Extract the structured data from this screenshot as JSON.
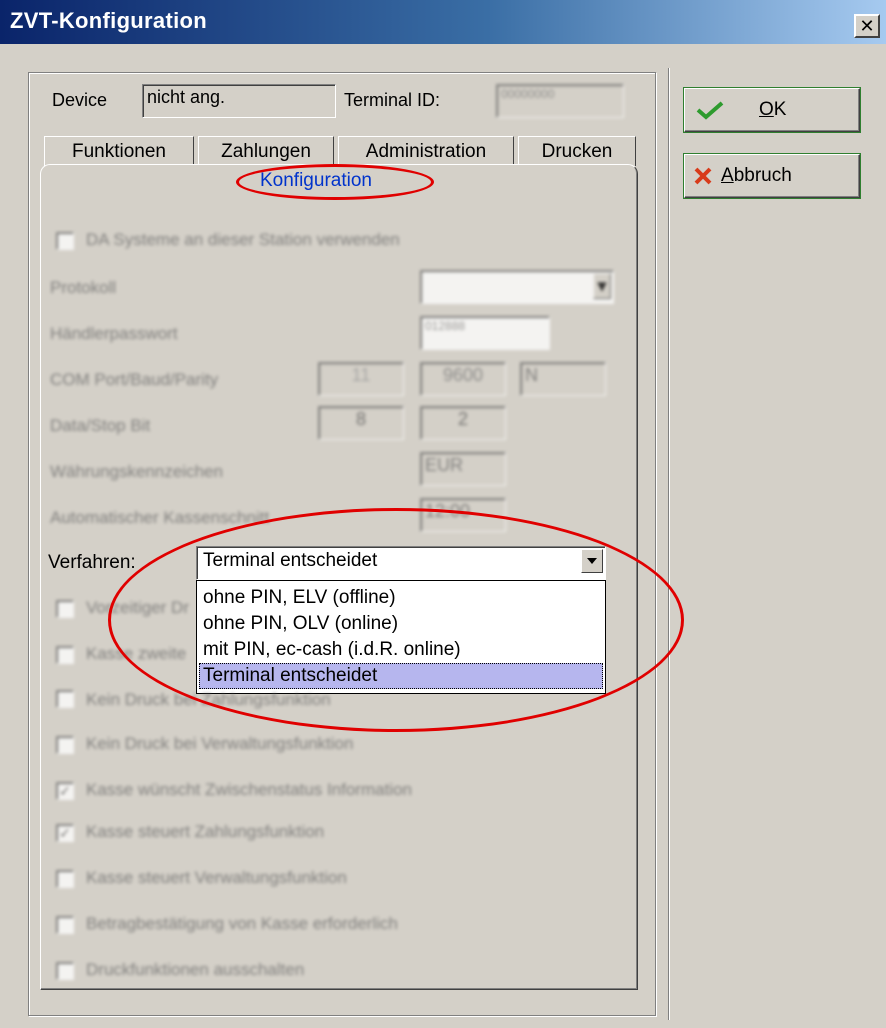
{
  "window": {
    "title": "ZVT-Konfiguration",
    "close_glyph": "✕"
  },
  "header": {
    "device_label": "Device",
    "device_value": "nicht ang.",
    "terminal_label": "Terminal ID:",
    "terminal_value": "00000000"
  },
  "tabs": {
    "row": [
      "Funktionen",
      "Zahlungen",
      "Administration",
      "Drucken"
    ],
    "active": "Konfiguration"
  },
  "blurred_form": {
    "checkbox_top": "DA Systeme an dieser Station verwenden",
    "protokoll_label": "Protokoll",
    "protokoll_value": "",
    "passwort_label": "Händlerpasswort",
    "passwort_value": "012888",
    "com_label": "COM Port/Baud/Parity",
    "com_port": "11",
    "com_baud": "9600",
    "com_parity": "N",
    "datastop_label": "Data/Stop Bit",
    "data_bit": "8",
    "stop_bit": "2",
    "waehrung_label": "Währungskennzeichen",
    "waehrung_value": "EUR",
    "kassenschnitt_label": "Automatischer Kassenschnitt",
    "kassenschnitt_value": "12:00"
  },
  "verfahren": {
    "label": "Verfahren:",
    "selected": "Terminal entscheidet",
    "options": [
      "ohne PIN, ELV (offline)",
      "ohne PIN, OLV (online)",
      "mit PIN, ec-cash (i.d.R. online)",
      "Terminal entscheidet"
    ]
  },
  "blurred_checkboxes": [
    {
      "label": "Vorzeitiger Druck",
      "checked": false
    },
    {
      "label": "Kasse zweite Stufe",
      "checked": false
    },
    {
      "label": "Kein Druck bei Zahlungsfunktion",
      "checked": false
    },
    {
      "label": "Kein Druck bei Verwaltungsfunktion",
      "checked": false
    },
    {
      "label": "Kasse wünscht Zwischenstatus Information",
      "checked": true
    },
    {
      "label": "Kasse steuert Zahlungsfunktion",
      "checked": true
    },
    {
      "label": "Kasse steuert Verwaltungsfunktion",
      "checked": false
    },
    {
      "label": "Betragbestätigung von Kasse erforderlich",
      "checked": false
    },
    {
      "label": "Druckfunktionen ausschalten",
      "checked": false
    }
  ],
  "buttons": {
    "ok_mnemonic": "O",
    "ok_rest": "K",
    "cancel_mnemonic": "A",
    "cancel_rest": "bbruch"
  },
  "colors": {
    "annotation": "#e00000",
    "tab_title": "#0033cc",
    "selection": "#b6b6ee"
  }
}
